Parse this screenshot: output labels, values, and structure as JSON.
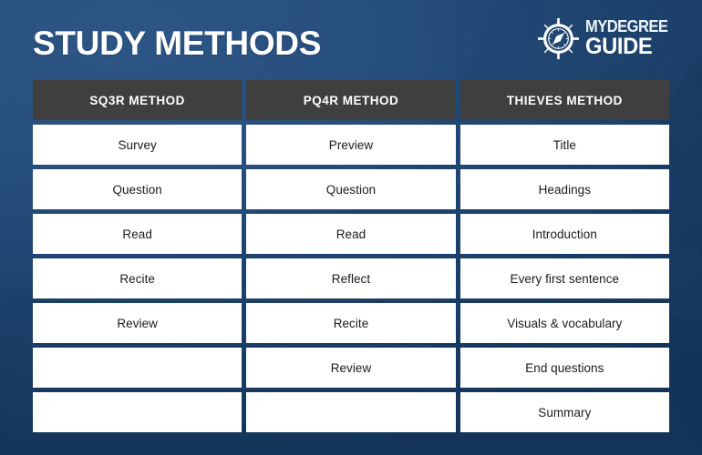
{
  "header": {
    "title": "STUDY METHODS",
    "logo": {
      "icon": "compass-icon",
      "line1": "MYDEGREE",
      "line2": "GUIDE"
    }
  },
  "theme": {
    "background_light": "#2d5585",
    "background_dark": "#143459",
    "header_cell": "#3f3f3f",
    "cell_background": "#ffffff",
    "cell_text": "#1b1b1b",
    "title_text": "#ffffff"
  },
  "table": {
    "columns": [
      "SQ3R METHOD",
      "PQ4R METHOD",
      "THIEVES METHOD"
    ],
    "rows": [
      [
        "Survey",
        "Preview",
        "Title"
      ],
      [
        "Question",
        "Question",
        "Headings"
      ],
      [
        "Read",
        "Read",
        "Introduction"
      ],
      [
        "Recite",
        "Reflect",
        "Every first sentence"
      ],
      [
        "Review",
        "Recite",
        "Visuals & vocabulary"
      ],
      [
        "",
        "Review",
        "End questions"
      ],
      [
        "",
        "",
        "Summary"
      ]
    ]
  }
}
